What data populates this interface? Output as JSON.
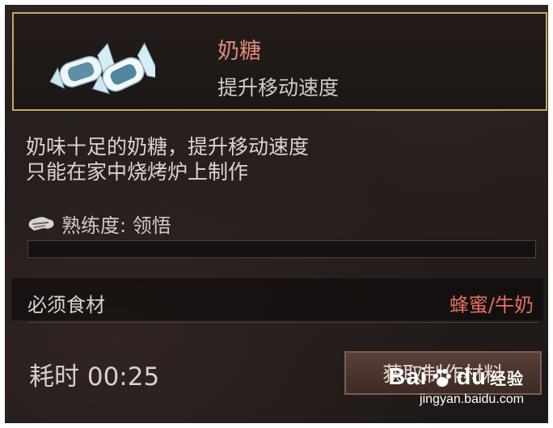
{
  "item": {
    "name": "奶糖",
    "effect": "提升移动速度",
    "image_icon": "milk-candy-icon"
  },
  "description": {
    "line1": "奶味十足的奶糖，提升移动速度",
    "line2": "只能在家中烧烤炉上制作"
  },
  "proficiency": {
    "icon": "proficiency-icon",
    "label": "熟练度: 领悟",
    "progress": 0
  },
  "ingredients": {
    "label": "必须食材",
    "value": "蜂蜜/牛奶"
  },
  "time": {
    "label": "耗时 00:25"
  },
  "actions": {
    "get_materials": "获取制作材料"
  },
  "watermark": {
    "brand": "Bai",
    "brand_tail": "du",
    "brand_cn": "经验",
    "url": "jingyan.baidu.com"
  },
  "colors": {
    "item_border": "#c9a56a",
    "item_name": "#e08a7b",
    "ingredient_value": "#e0705f",
    "panel_bg": "#221c1b"
  }
}
